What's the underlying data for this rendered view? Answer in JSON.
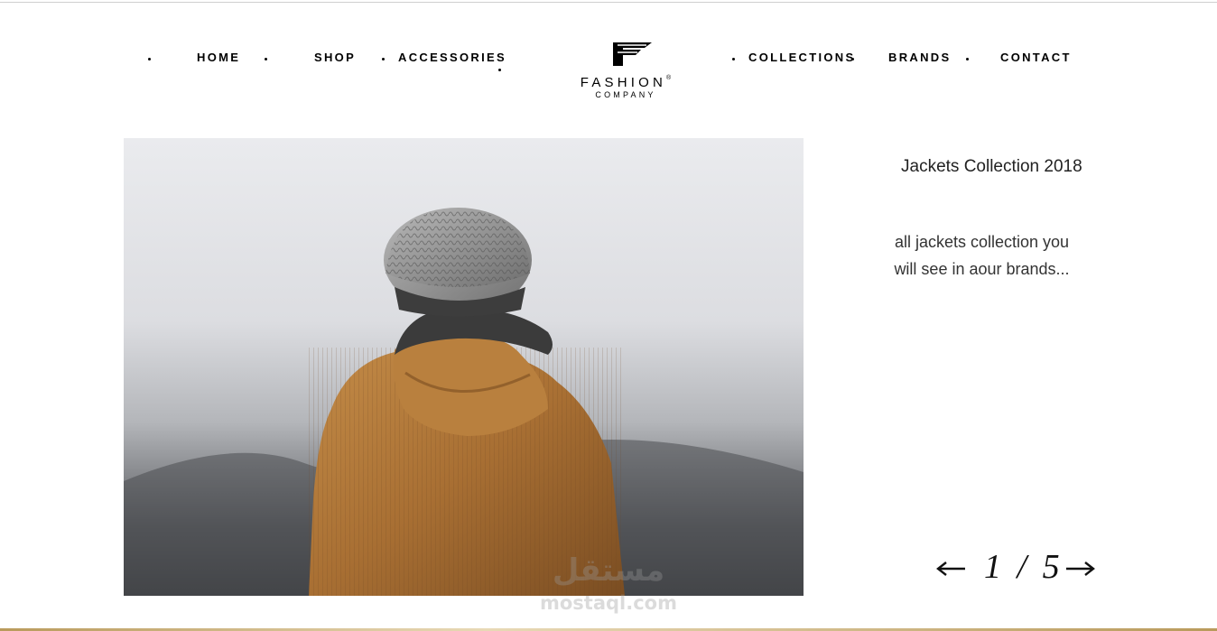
{
  "nav": {
    "left": [
      "HOME",
      "SHOP",
      "ACCESSORIES"
    ],
    "right": [
      "COLLECTIONS",
      "BRANDS",
      "CONTACT"
    ]
  },
  "logo": {
    "word": "FASHION",
    "registered": "®",
    "sub": "COMPANY"
  },
  "slide": {
    "title": "Jackets Collection 2018",
    "description_line1": "all jackets collection you",
    "description_line2": "will see in aour brands...",
    "current": "1",
    "separator": "/",
    "total": "5",
    "image_icon": "person-in-hooded-jacket-and-beanie-photo"
  },
  "pager_icons": {
    "prev": "arrow-left-icon",
    "next": "arrow-right-icon"
  },
  "watermark": {
    "arabic": "مستقل",
    "latin": "mostaql.com"
  },
  "colors": {
    "text": "#111111",
    "jacket": "#b07a3a",
    "beanie": "#8a8a8a",
    "accent_rule": "#b99a5b"
  }
}
